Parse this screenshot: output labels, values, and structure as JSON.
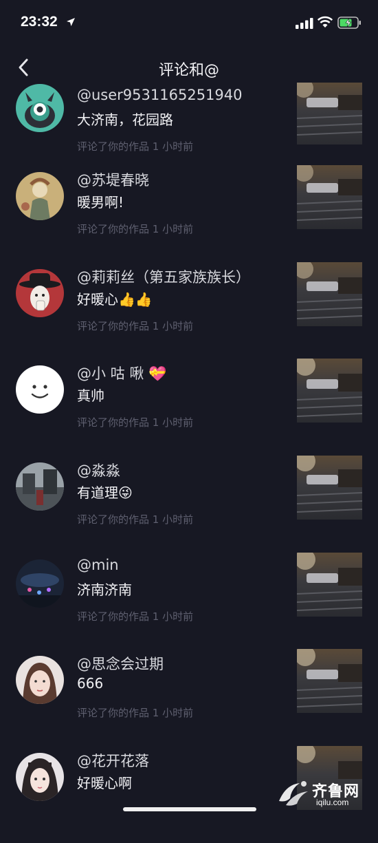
{
  "status_bar": {
    "time": "23:32"
  },
  "header": {
    "title": "评论和@"
  },
  "comments": [
    {
      "user": "@user9531165251940",
      "text": "大济南，花园路",
      "meta": "评论了你的作品  1 小时前",
      "avatar": "green-monster-avatar"
    },
    {
      "user": "@苏堤春晓",
      "text": "暖男啊!",
      "meta": "评论了你的作品  1 小时前",
      "avatar": "painting-avatar"
    },
    {
      "user": "@莉莉丝（第五家族族长）",
      "text": "好暖心",
      "emoji": "👍👍",
      "meta": "评论了你的作品  1 小时前",
      "avatar": "red-hat-avatar"
    },
    {
      "user": "@小 咕 啾",
      "user_emoji": "💝",
      "text": "真帅",
      "meta": "评论了你的作品  1 小时前",
      "avatar": "smiley-avatar"
    },
    {
      "user": "@淼淼",
      "text": "有道理",
      "emoji": "😜",
      "meta": "评论了你的作品  1 小时前",
      "avatar": "photo-avatar"
    },
    {
      "user": "@min",
      "text": "济南济南",
      "meta": "评论了你的作品  1 小时前",
      "avatar": "night-city-avatar"
    },
    {
      "user": "@思念会过期",
      "text": "666",
      "meta": "评论了你的作品  1 小时前",
      "avatar": "woman-avatar"
    },
    {
      "user": "@花开花落",
      "text": "好暖心啊",
      "meta": "",
      "avatar": "girl-avatar"
    }
  ],
  "watermark": {
    "text": "齐鲁网",
    "sub": "iqilu.com"
  }
}
